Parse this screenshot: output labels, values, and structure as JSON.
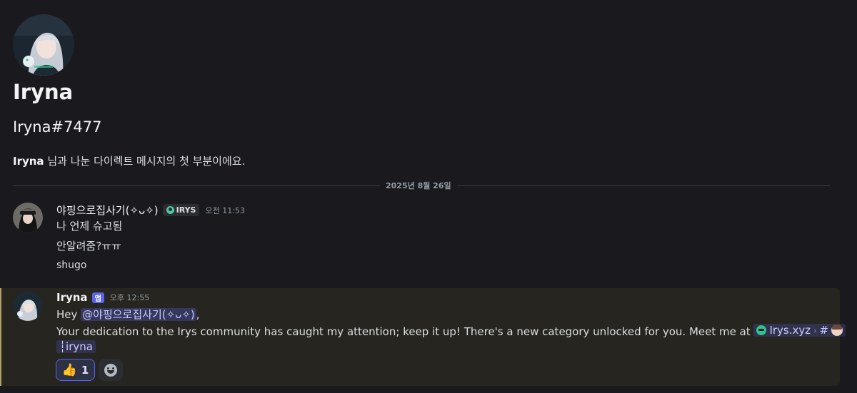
{
  "profile": {
    "name": "Iryna",
    "tag": "Iryna#7477",
    "intro_name": "Iryna",
    "intro_text": " 님과 나눈 다이렉트 메시지의 첫 부분이에요."
  },
  "divider": {
    "date": "2025년 8월 26일"
  },
  "messages": [
    {
      "username": "야핑으로집사기(✧ᴗ✧)",
      "clan_tag": "IRYS",
      "timestamp": "오전 11:53",
      "lines": [
        "나 언제 슈고됨",
        "안알려줌?ㅠㅠ",
        "shugo"
      ]
    },
    {
      "username": "Iryna",
      "badge": "앱",
      "timestamp": "오후 12:55",
      "greeting": "Hey ",
      "mention": "@야핑으로집사기(✧ᴗ✧)",
      "greeting_tail": ",",
      "body": "Your dedication to the Irys community has caught my attention; keep it up! There's a new category unlocked for you. Meet me at ",
      "link_server": "Irys.xyz",
      "link_sep": "›",
      "link_hash": "#",
      "link_channel": "┆iryna",
      "reaction": {
        "emoji": "👍",
        "count": "1"
      }
    }
  ],
  "icons": {
    "reaction_add": "smile-icon",
    "server": "globe-icon",
    "clan": "clan-icon"
  },
  "colors": {
    "background": "#1a1a1e",
    "highlight": "#272520",
    "accent": "#5865f2",
    "mention_text": "#c9cdfb"
  }
}
